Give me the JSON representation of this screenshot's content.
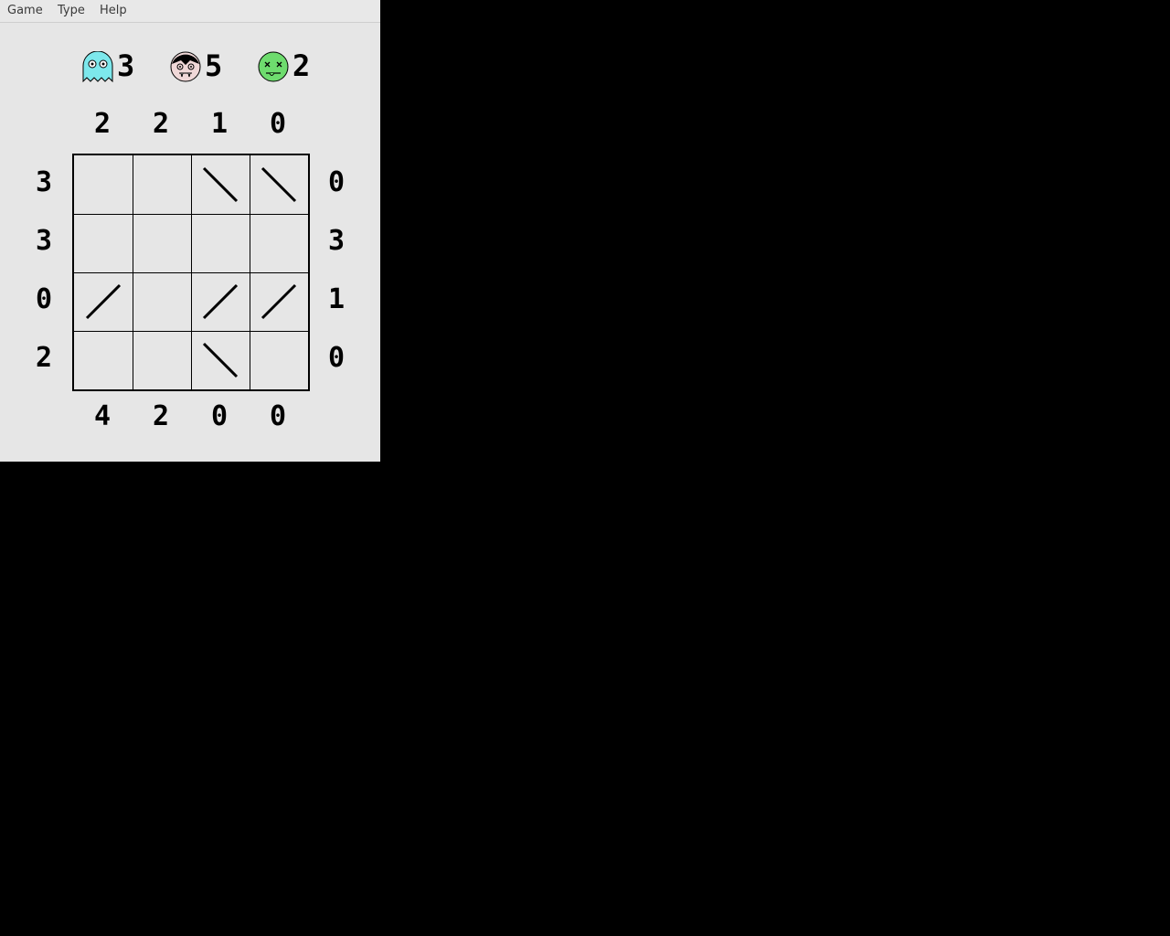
{
  "menu": [
    "Game",
    "Type",
    "Help"
  ],
  "monsters": [
    {
      "name": "ghost-icon",
      "count": "3",
      "color": "#7de8ec"
    },
    {
      "name": "vampire-icon",
      "count": "5",
      "color": "#f0d8d8"
    },
    {
      "name": "zombie-icon",
      "count": "2",
      "color": "#6edc6e"
    }
  ],
  "clues": {
    "top": [
      "2",
      "2",
      "1",
      "0"
    ],
    "bottom": [
      "4",
      "2",
      "0",
      "0"
    ],
    "left": [
      "3",
      "3",
      "0",
      "2"
    ],
    "right": [
      "0",
      "3",
      "1",
      "0"
    ]
  },
  "grid": [
    [
      "",
      "",
      "\\",
      "\\"
    ],
    [
      "",
      "",
      "",
      ""
    ],
    [
      "/",
      "",
      "/",
      "/"
    ],
    [
      "",
      "",
      "\\",
      ""
    ]
  ]
}
